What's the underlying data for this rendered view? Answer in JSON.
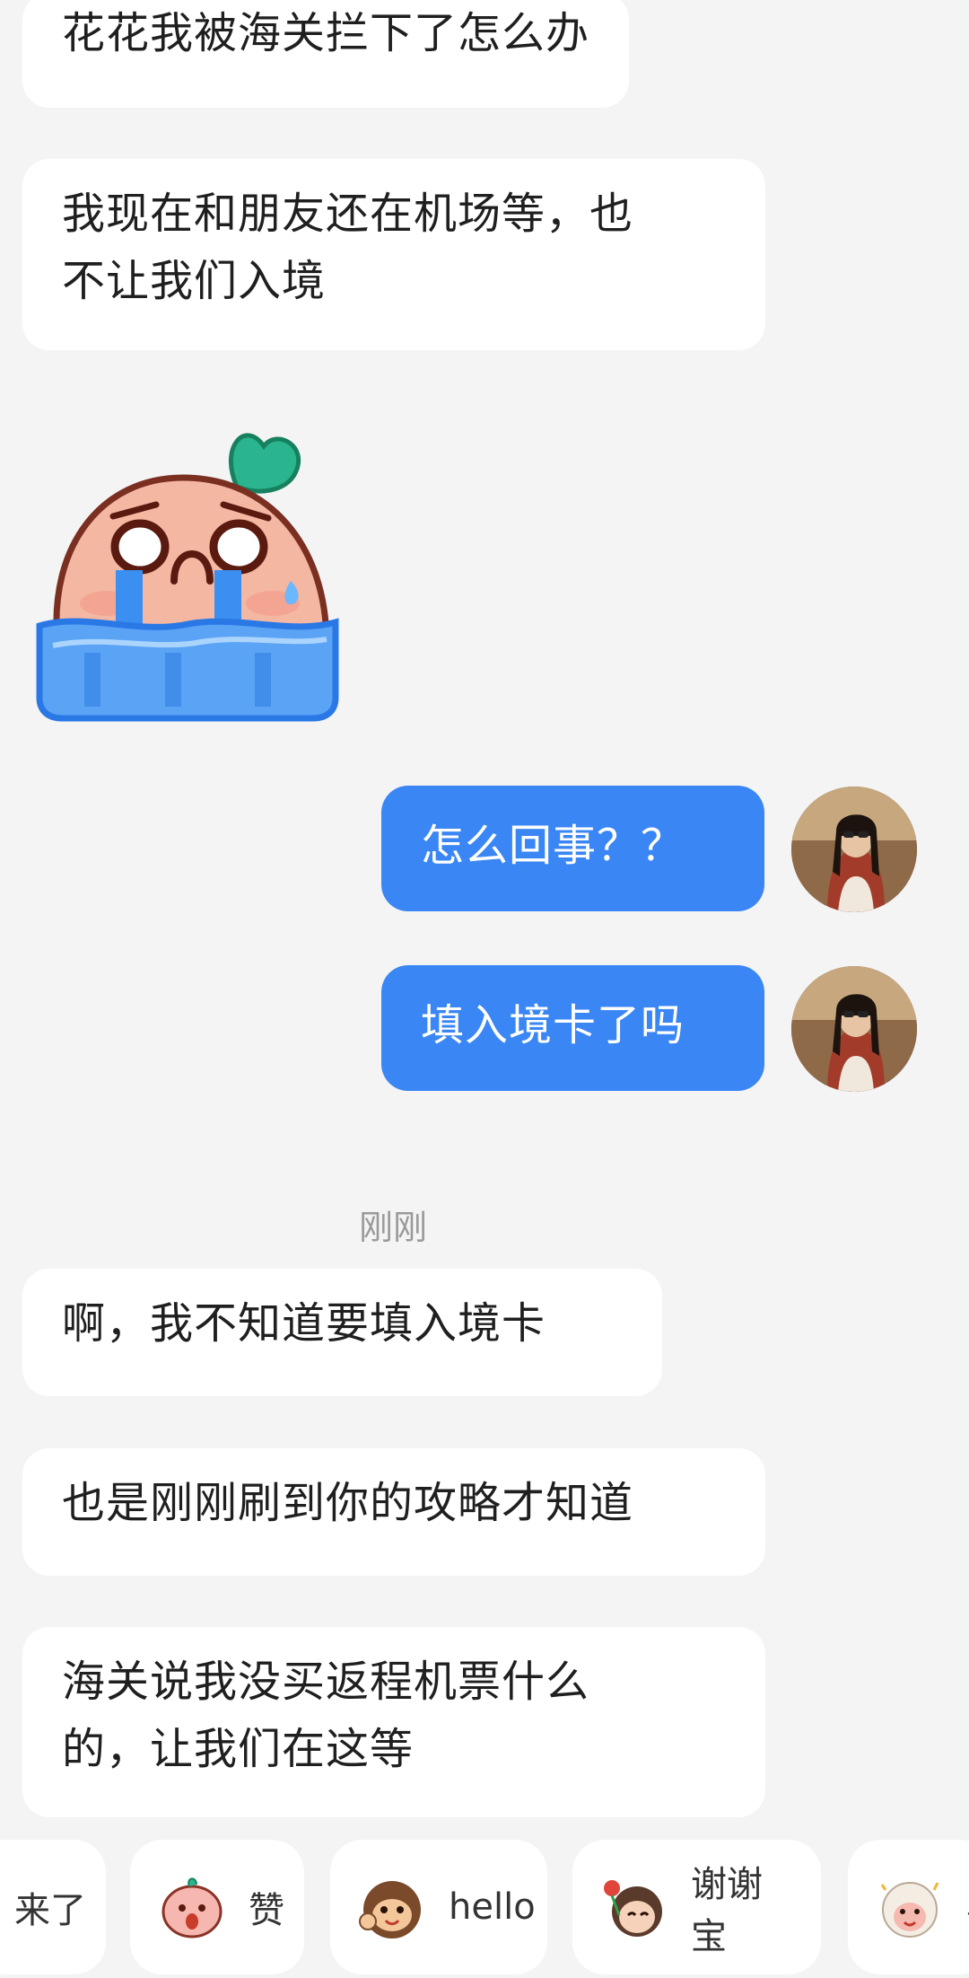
{
  "messages": {
    "m1": "花花我被海关拦下了怎么办",
    "m2_line1": "我现在和朋友还在机场等，也",
    "m2_line2": "不让我们入境",
    "out1": "怎么回事？？",
    "out2": "填入境卡了吗",
    "timestamp": "刚刚",
    "m3": "啊，我不知道要填入境卡",
    "m4": "也是刚刚刷到你的攻略才知道",
    "m5_line1": "海关说我没买返程机票什么",
    "m5_line2": "的，让我们在这等"
  },
  "quick_replies": {
    "chip0": "来了",
    "chip1": "赞",
    "chip2": "hello",
    "chip3": "谢谢宝",
    "chip4": "喜"
  },
  "colors": {
    "background": "#f4f4f5",
    "incoming_bubble": "#ffffff",
    "outgoing_bubble": "#3a86f4"
  },
  "icons": {
    "sticker": "crying-peach-sticker",
    "avatar": "user-avatar-photo"
  }
}
